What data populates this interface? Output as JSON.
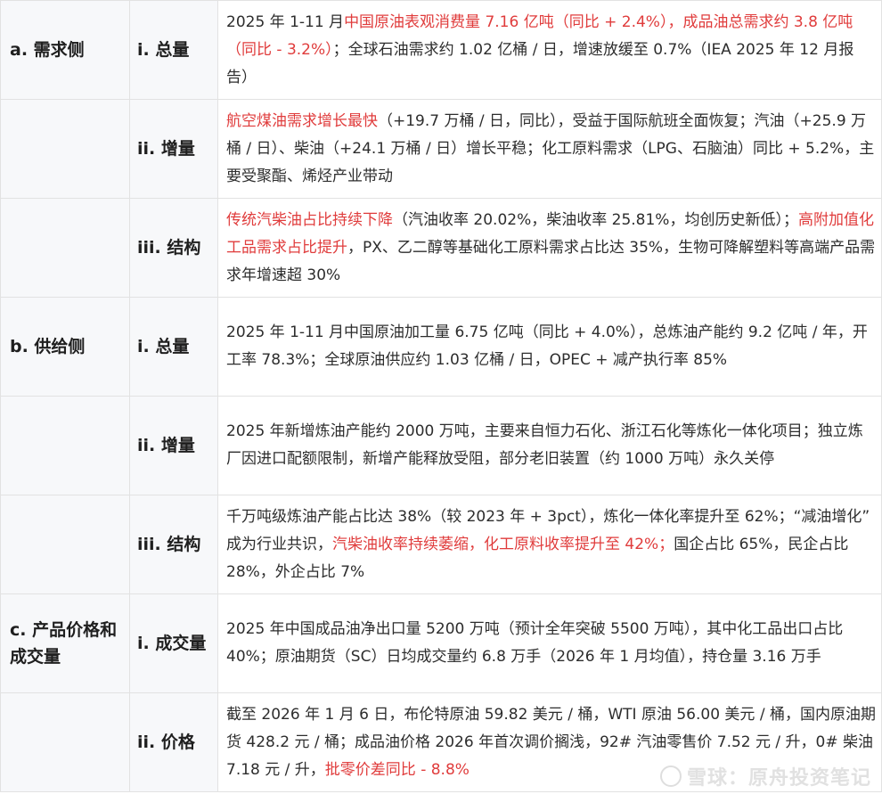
{
  "rows": [
    {
      "section": "a. 需求侧",
      "sub": "i. 总量",
      "segments": [
        {
          "t": "2025 年 1-11 月"
        },
        {
          "t": "中国原油表观消费量 7.16 亿吨（同比 + 2.4%），成品油总需求约 3.8 亿吨（同比 - 3.2%）",
          "hl": true
        },
        {
          "t": "；全球石油需求约 1.02 亿桶 / 日，增速放缓至 0.7%（IEA 2025 年 12 月报告）"
        }
      ]
    },
    {
      "section": "",
      "sub": "ii. 增量",
      "segments": [
        {
          "t": "航空煤油需求增长最快",
          "hl": true
        },
        {
          "t": "（+19.7 万桶 / 日，同比），受益于国际航班全面恢复；汽油（+25.9 万桶 / 日）、柴油（+24.1 万桶 / 日）增长平稳；化工原料需求（LPG、石脑油）同比 + 5.2%，主要受聚酯、烯烃产业带动"
        }
      ]
    },
    {
      "section": "",
      "sub": "iii. 结构",
      "segments": [
        {
          "t": "传统汽柴油占比持续下降",
          "hl": true
        },
        {
          "t": "（汽油收率 20.02%，柴油收率 25.81%，均创历史新低）；"
        },
        {
          "t": "高附加值化工品需求占比提升",
          "hl": true
        },
        {
          "t": "，PX、乙二醇等基础化工原料需求占比达 35%，生物可降解塑料等高端产品需求年增速超 30%"
        }
      ]
    },
    {
      "section": "b. 供给侧",
      "sub": "i. 总量",
      "segments": [
        {
          "t": "2025 年 1-11 月中国原油加工量 6.75 亿吨（同比 + 4.0%），总炼油产能约 9.2 亿吨 / 年，开工率 78.3%；全球原油供应约 1.03 亿桶 / 日，OPEC + 减产执行率 85%"
        }
      ]
    },
    {
      "section": "",
      "sub": "ii. 增量",
      "segments": [
        {
          "t": "2025 年新增炼油产能约 2000 万吨，主要来自恒力石化、浙江石化等炼化一体化项目；独立炼厂因进口配额限制，新增产能释放受阻，部分老旧装置（约 1000 万吨）永久关停"
        }
      ]
    },
    {
      "section": "",
      "sub": "iii. 结构",
      "segments": [
        {
          "t": "千万吨级炼油产能占比达 38%（较 2023 年 + 3pct），炼化一体化率提升至 62%；“减油增化” 成为行业共识，"
        },
        {
          "t": "汽柴油收率持续萎缩，化工原料收率提升至 42%；",
          "hl": true
        },
        {
          "t": "国企占比 65%，民企占比 28%，外企占比 7%"
        }
      ]
    },
    {
      "section": "c. 产品价格和成交量",
      "sub": "i. 成交量",
      "segments": [
        {
          "t": "2025 年中国成品油净出口量 5200 万吨（预计全年突破 5500 万吨），其中化工品出口占比 40%；原油期货（SC）日均成交量约 6.8 万手（2026 年 1 月均值），持仓量 3.16 万手"
        }
      ]
    },
    {
      "section": "",
      "sub": "ii. 价格",
      "segments": [
        {
          "t": "截至 2026 年 1 月 6 日，布伦特原油 59.82 美元 / 桶，WTI 原油 56.00 美元 / 桶，国内原油期货 428.2 元 / 桶；成品油价格 2026 年首次调价搁浅，92# 汽油零售价 7.52 元 / 升，0# 柴油 7.18 元 / 升，"
        },
        {
          "t": "批零价差同比 - 8.8%",
          "hl": true
        }
      ]
    }
  ],
  "watermark": "雪球：原舟投资笔记"
}
